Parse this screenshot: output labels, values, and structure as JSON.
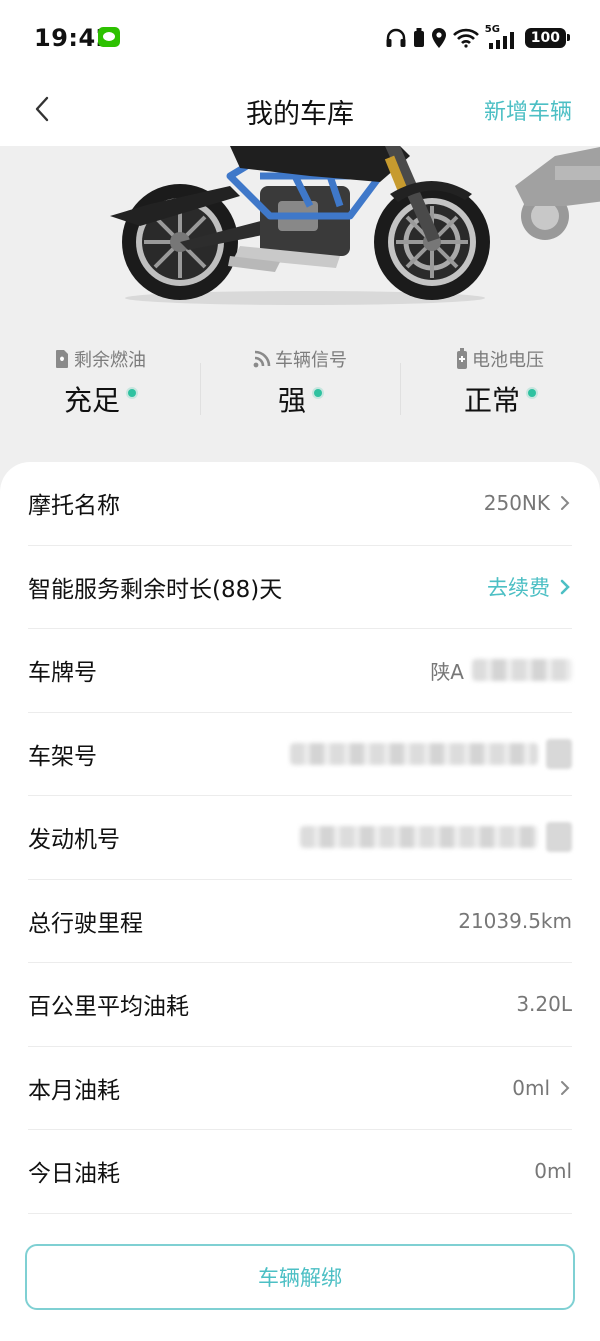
{
  "status_bar": {
    "time": "19:42",
    "network": "5G",
    "battery": "100",
    "icons": [
      "wechat-icon",
      "headphones-icon",
      "sim-icon",
      "location-icon",
      "wifi-icon",
      "signal-icon",
      "battery-icon"
    ]
  },
  "header": {
    "title": "我的车库",
    "action_label": "新增车辆",
    "back_icon": "back-arrow-icon"
  },
  "stats": [
    {
      "label": "剩余燃油",
      "value": "充足",
      "icon": "fuel-icon"
    },
    {
      "label": "车辆信号",
      "value": "强",
      "icon": "signal-wave-icon"
    },
    {
      "label": "电池电压",
      "value": "正常",
      "icon": "battery-icon"
    }
  ],
  "details": {
    "moto_name": {
      "label": "摩托名称",
      "value": "250NK"
    },
    "service": {
      "label": "智能服务剩余时长(88)天",
      "value": "去续费"
    },
    "plate": {
      "label": "车牌号",
      "value": "陕A"
    },
    "frame": {
      "label": "车架号"
    },
    "engine": {
      "label": "发动机号"
    },
    "mileage": {
      "label": "总行驶里程",
      "value": "21039.5km"
    },
    "avg_fuel": {
      "label": "百公里平均油耗",
      "value": "3.20L"
    },
    "month_fuel": {
      "label": "本月油耗",
      "value": "0ml"
    },
    "today_fuel": {
      "label": "今日油耗",
      "value": "0ml"
    }
  },
  "buttons": {
    "unbind": "车辆解绑"
  },
  "colors": {
    "accent": "#4cbfc4",
    "status_ok": "#2fc2a0",
    "frame_blue": "#3f78c9"
  }
}
